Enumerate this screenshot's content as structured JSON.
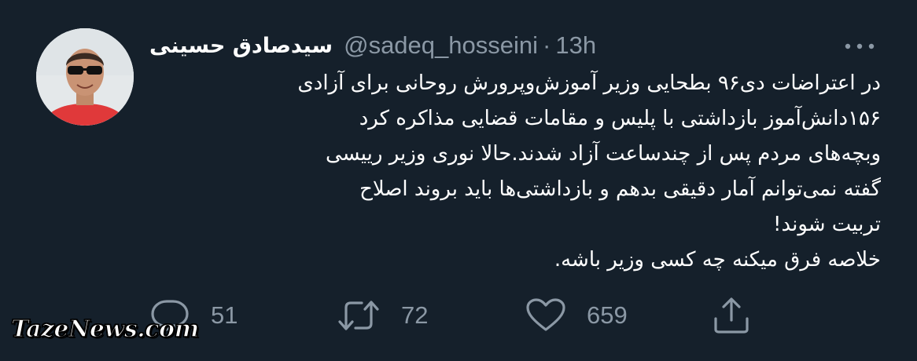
{
  "tweet": {
    "display_name": "سیدصادق حسینی",
    "handle": "@sadeq_hosseini",
    "separator": "·",
    "time": "13h",
    "body_lines": [
      "در اعتراضات دی۹۶ بطحایی وزیر آموزش‌وپرورش روحانی برای آزادی",
      "۱۵۶دانش‌آموز بازداشتی با پلیس و مقامات قضایی مذاکره کرد",
      "وبچه‌های مردم پس از چندساعت آزاد شدند.حالا نوری وزیر رییسی",
      "گفته نمی‌توانم آمار دقیقی بدهم و بازداشتی‌ها باید بروند اصلاح",
      "تربیت شوند!",
      "خلاصه فرق میکنه چه کسی وزیر باشه."
    ]
  },
  "actions": {
    "reply_count": "51",
    "retweet_count": "72",
    "like_count": "659"
  },
  "icons": {
    "more": "more-dots-icon",
    "reply": "reply-bubble-icon",
    "retweet": "retweet-icon",
    "like": "heart-icon",
    "share": "share-icon"
  },
  "watermark": "TazeNews.com",
  "colors": {
    "background": "#15202b",
    "text": "#ffffff",
    "secondary": "#8b98a5"
  }
}
